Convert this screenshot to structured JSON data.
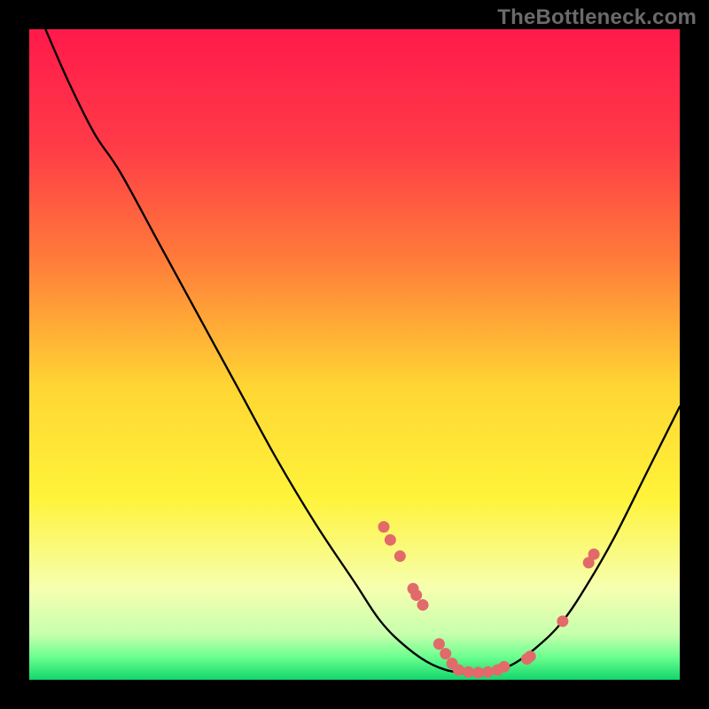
{
  "watermark": "TheBottleneck.com",
  "chart_data": {
    "type": "line",
    "title": "",
    "xlabel": "",
    "ylabel": "",
    "xlim": [
      0,
      100
    ],
    "ylim": [
      0,
      100
    ],
    "gradient_stops": [
      {
        "offset": 0,
        "color": "#ff1a4b"
      },
      {
        "offset": 18,
        "color": "#ff3b47"
      },
      {
        "offset": 35,
        "color": "#ff7a3a"
      },
      {
        "offset": 55,
        "color": "#ffd633"
      },
      {
        "offset": 72,
        "color": "#fff33a"
      },
      {
        "offset": 86,
        "color": "#f6ffb0"
      },
      {
        "offset": 93,
        "color": "#c7ffad"
      },
      {
        "offset": 96.5,
        "color": "#6bff8f"
      },
      {
        "offset": 100,
        "color": "#12d66b"
      }
    ],
    "series": [
      {
        "name": "bottleneck-curve",
        "color": "#000000",
        "points": [
          {
            "x": 2.5,
            "y": 100
          },
          {
            "x": 6,
            "y": 92
          },
          {
            "x": 10,
            "y": 84
          },
          {
            "x": 14,
            "y": 78
          },
          {
            "x": 20,
            "y": 67
          },
          {
            "x": 26,
            "y": 56
          },
          {
            "x": 32,
            "y": 45
          },
          {
            "x": 38,
            "y": 34
          },
          {
            "x": 44,
            "y": 24
          },
          {
            "x": 50,
            "y": 15
          },
          {
            "x": 54,
            "y": 9
          },
          {
            "x": 58,
            "y": 5
          },
          {
            "x": 62,
            "y": 2.3
          },
          {
            "x": 66,
            "y": 1.1
          },
          {
            "x": 70,
            "y": 1.0
          },
          {
            "x": 74,
            "y": 2.2
          },
          {
            "x": 78,
            "y": 5
          },
          {
            "x": 82,
            "y": 9
          },
          {
            "x": 86,
            "y": 15
          },
          {
            "x": 90,
            "y": 22
          },
          {
            "x": 95,
            "y": 32
          },
          {
            "x": 100,
            "y": 42
          }
        ]
      }
    ],
    "scatter": {
      "name": "data-points",
      "color": "#e26a6a",
      "radius": 6.5,
      "points": [
        {
          "x": 54.5,
          "y": 23.5
        },
        {
          "x": 55.5,
          "y": 21.5
        },
        {
          "x": 57.0,
          "y": 19.0
        },
        {
          "x": 59.0,
          "y": 14.0
        },
        {
          "x": 59.5,
          "y": 13.0
        },
        {
          "x": 60.5,
          "y": 11.5
        },
        {
          "x": 63.0,
          "y": 5.5
        },
        {
          "x": 64.0,
          "y": 4.0
        },
        {
          "x": 65.0,
          "y": 2.5
        },
        {
          "x": 66.0,
          "y": 1.5
        },
        {
          "x": 67.5,
          "y": 1.2
        },
        {
          "x": 69.0,
          "y": 1.1
        },
        {
          "x": 70.5,
          "y": 1.2
        },
        {
          "x": 72.0,
          "y": 1.5
        },
        {
          "x": 73.0,
          "y": 2.0
        },
        {
          "x": 76.5,
          "y": 3.2
        },
        {
          "x": 77.0,
          "y": 3.6
        },
        {
          "x": 82.0,
          "y": 9.0
        },
        {
          "x": 86.0,
          "y": 18.0
        },
        {
          "x": 86.8,
          "y": 19.3
        }
      ]
    }
  }
}
